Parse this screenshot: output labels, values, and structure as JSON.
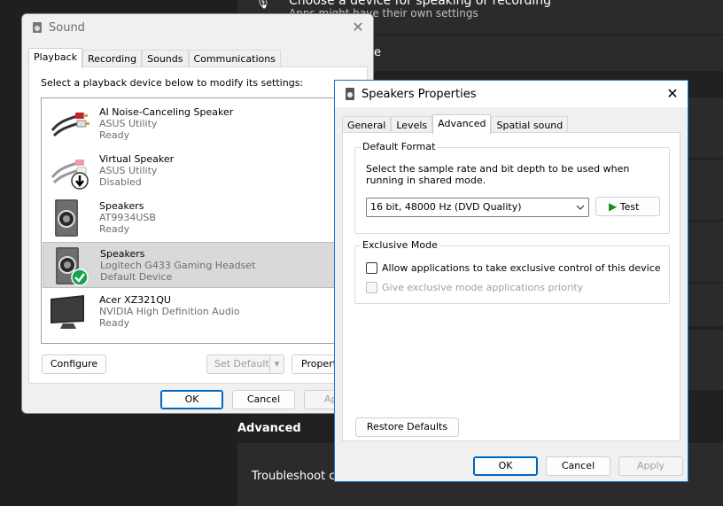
{
  "background": {
    "header_line1": "Choose a device for speaking or recording",
    "header_line2": "Apps might have their own settings",
    "partial_label": "e",
    "advanced_label": "Advanced",
    "troubleshoot_label": "Troubleshoot co"
  },
  "sound": {
    "title": "Sound",
    "tabs": [
      "Playback",
      "Recording",
      "Sounds",
      "Communications"
    ],
    "instruction": "Select a playback device below to modify its settings:",
    "devices": [
      {
        "name": "AI Noise-Canceling Speaker",
        "driver": "ASUS Utility",
        "status": "Ready",
        "icon": "rca-cable-icon"
      },
      {
        "name": "Virtual Speaker",
        "driver": "ASUS Utility",
        "status": "Disabled",
        "icon": "rca-cable-disabled-icon"
      },
      {
        "name": "Speakers",
        "driver": "AT9934USB",
        "status": "Ready",
        "icon": "speaker-icon"
      },
      {
        "name": "Speakers",
        "driver": "Logitech G433 Gaming Headset",
        "status": "Default Device",
        "icon": "speaker-default-icon"
      },
      {
        "name": "Acer XZ321QU",
        "driver": "NVIDIA High Definition Audio",
        "status": "Ready",
        "icon": "monitor-icon"
      }
    ],
    "configure": "Configure",
    "set_default": "Set Default",
    "properties": "Propert",
    "ok": "OK",
    "cancel": "Cancel",
    "apply": "Ap"
  },
  "props": {
    "title": "Speakers Properties",
    "tabs": [
      "General",
      "Levels",
      "Advanced",
      "Spatial sound"
    ],
    "default_format": {
      "title": "Default Format",
      "description": "Select the sample rate and bit depth to be used when running in shared mode.",
      "selected": "16 bit, 48000 Hz (DVD Quality)",
      "test": "Test"
    },
    "exclusive": {
      "title": "Exclusive Mode",
      "allow": "Allow applications to take exclusive control of this device",
      "priority": "Give exclusive mode applications priority"
    },
    "restore": "Restore Defaults",
    "ok": "OK",
    "cancel": "Cancel",
    "apply": "Apply"
  },
  "colors": {
    "accent": "#0067c0",
    "test_green": "#1e8c1e",
    "default_check": "#16a34a"
  }
}
